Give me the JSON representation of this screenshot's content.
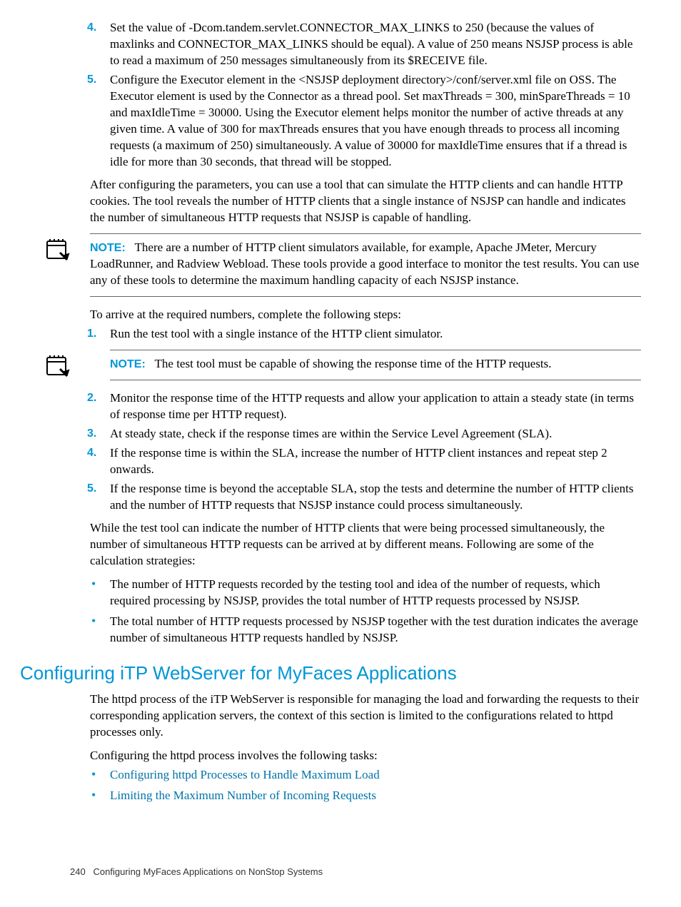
{
  "steps_a": [
    {
      "num": "4.",
      "text": "Set the value of -Dcom.tandem.servlet.CONNECTOR_MAX_LINKS to 250 (because the values of maxlinks and CONNECTOR_MAX_LINKS should be equal). A value of 250 means NSJSP process is able to read a maximum of 250 messages simultaneously from its $RECEIVE file."
    },
    {
      "num": "5.",
      "text": "Configure the Executor element in the <NSJSP deployment directory>/conf/server.xml file on OSS. The Executor element is used by the Connector as a thread pool. Set maxThreads = 300, minSpareThreads = 10 and maxIdleTime = 30000. Using the Executor element helps monitor the number of active threads at any given time. A value of 300 for maxThreads ensures that you have enough threads to process all incoming requests (a maximum of 250) simultaneously. A value of 30000 for maxIdleTime ensures that if a thread is idle for more than 30 seconds, that thread will be stopped."
    }
  ],
  "para_after_configure": "After configuring the parameters, you can use a tool that can simulate the HTTP clients and can handle HTTP cookies. The tool reveals the number of HTTP clients that a single instance of NSJSP can handle and indicates the number of simultaneous HTTP requests that NSJSP is capable of handling.",
  "note1_label": "NOTE:",
  "note1_text": "There are a number of HTTP client simulators available, for example, Apache JMeter, Mercury LoadRunner, and Radview Webload. These tools provide a good interface to monitor the test results. You can use any of these tools to determine the maximum handling capacity of each NSJSP instance.",
  "para_arrive": "To arrive at the required numbers, complete the following steps:",
  "steps_b1": [
    {
      "num": "1.",
      "text": "Run the test tool with a single instance of the HTTP client simulator."
    }
  ],
  "note2_label": "NOTE:",
  "note2_text": "The test tool must be capable of showing the response time of the HTTP requests.",
  "steps_b2": [
    {
      "num": "2.",
      "text": "Monitor the response time of the HTTP requests and allow your application to attain a steady state (in terms of response time per HTTP request)."
    },
    {
      "num": "3.",
      "text": "At steady state, check if the response times are within the Service Level Agreement (SLA)."
    },
    {
      "num": "4.",
      "text": "If the response time is within the SLA, increase the number of HTTP client instances and repeat step 2 onwards."
    },
    {
      "num": "5.",
      "text": "If the response time is beyond the acceptable SLA, stop the tests and determine the number of HTTP clients and the number of HTTP requests that NSJSP instance could process simultaneously."
    }
  ],
  "para_while": "While the test tool can indicate the number of HTTP clients that were being processed simultaneously, the number of simultaneous HTTP requests can be arrived at by different means. Following are some of the calculation strategies:",
  "bullets_calc": [
    "The number of HTTP requests recorded by the testing tool and idea of the number of requests, which required processing by NSJSP, provides the total number of HTTP requests processed by NSJSP.",
    "The total number of HTTP requests processed by NSJSP together with the test duration indicates the average number of simultaneous HTTP requests handled by NSJSP."
  ],
  "section_heading": "Configuring iTP WebServer for MyFaces Applications",
  "para_httpd": "The httpd process of the iTP WebServer is responsible for managing the load and forwarding the requests to their corresponding application servers, the context of this section is limited to the configurations related to httpd processes only.",
  "para_config_httpd": "Configuring the httpd process involves the following tasks:",
  "bullets_links": [
    "Configuring httpd Processes to Handle Maximum Load",
    "Limiting the Maximum Number of Incoming Requests"
  ],
  "footer_page": "240",
  "footer_text": "Configuring MyFaces Applications on NonStop Systems"
}
